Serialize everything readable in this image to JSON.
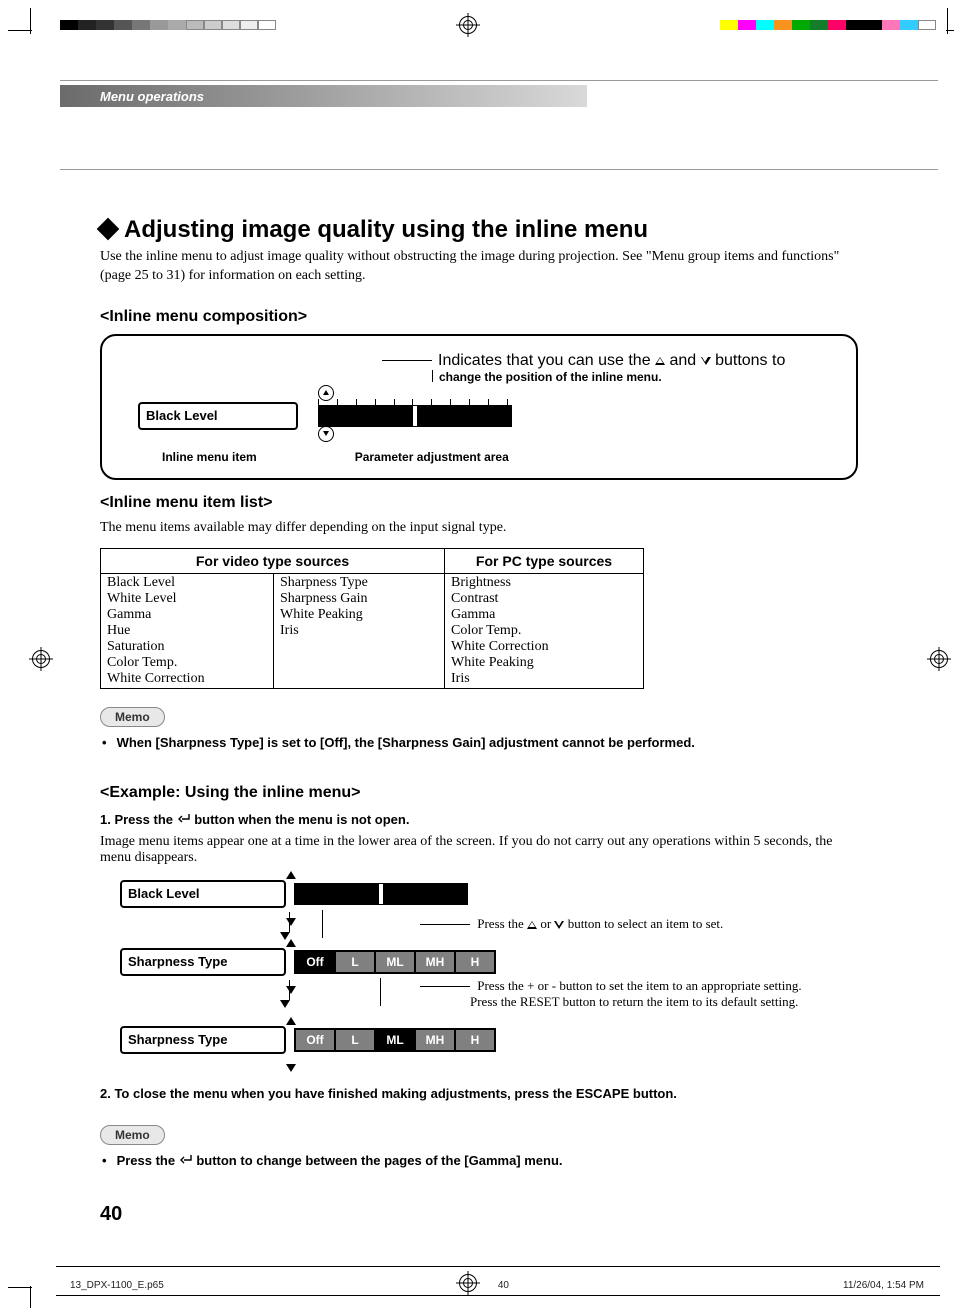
{
  "header": {
    "section": "Menu operations"
  },
  "title": "Adjusting image quality using the inline menu",
  "intro": "Use the inline menu to adjust image quality without obstructing the image during projection. See \"Menu group items and functions\" (page 25 to 31) for information on each setting.",
  "composition": {
    "heading": "<Inline menu composition>",
    "caption_a": "Indicates that you can use the ",
    "caption_b": " and ",
    "caption_c": " buttons to",
    "caption_line2": "change the position of the inline menu.",
    "item_label": "Black Level",
    "label_item": "Inline menu item",
    "label_area": "Parameter adjustment area"
  },
  "itemlist": {
    "heading": "<Inline menu item list>",
    "note": "The menu items available may differ depending on the input signal type.",
    "head_video": "For video type sources",
    "head_pc": "For PC type sources",
    "video_a": [
      "Black Level",
      "White Level",
      "Gamma",
      "Hue",
      "Saturation",
      "Color Temp.",
      "White Correction"
    ],
    "video_b": [
      "Sharpness Type",
      "Sharpness Gain",
      "White Peaking",
      "Iris"
    ],
    "pc": [
      "Brightness",
      "Contrast",
      "Gamma",
      "Color Temp.",
      "White Correction",
      "White Peaking",
      "Iris"
    ]
  },
  "memo1": {
    "pill": "Memo",
    "text": "When [Sharpness Type] is set to [Off], the [Sharpness Gain] adjustment cannot be performed."
  },
  "example": {
    "heading": "<Example: Using the inline menu>",
    "step1_a": "1.   Press the ",
    "step1_b": " button when the menu is not open.",
    "step1_body": "Image menu items appear one at a time in the lower area of the screen. If you do not carry out any operations within 5 seconds, the menu disappears.",
    "row1_label": "Black Level",
    "cap1_a": "Press the ",
    "cap1_b": " or ",
    "cap1_c": " button to select an item to set.",
    "row2_label": "Sharpness Type",
    "row2_opts": [
      "Off",
      "L",
      "ML",
      "MH",
      "H"
    ],
    "row2_sel": 0,
    "cap2_line1": "Press the + or - button to set the item to an appropriate setting.",
    "cap2_line2": "Press the RESET button to return the item to its default setting.",
    "row3_label": "Sharpness Type",
    "row3_opts": [
      "Off",
      "L",
      "ML",
      "MH",
      "H"
    ],
    "row3_sel": 2,
    "step2": "2.   To close the menu when you have finished making adjustments, press the ESCAPE button."
  },
  "memo2": {
    "pill": "Memo",
    "text_a": "Press the ",
    "text_b": " button to change between the pages of the [Gamma] menu."
  },
  "page_number": "40",
  "footer": {
    "file": "13_DPX-1100_E.p65",
    "page": "40",
    "date": "11/26/04, 1:54 PM"
  }
}
